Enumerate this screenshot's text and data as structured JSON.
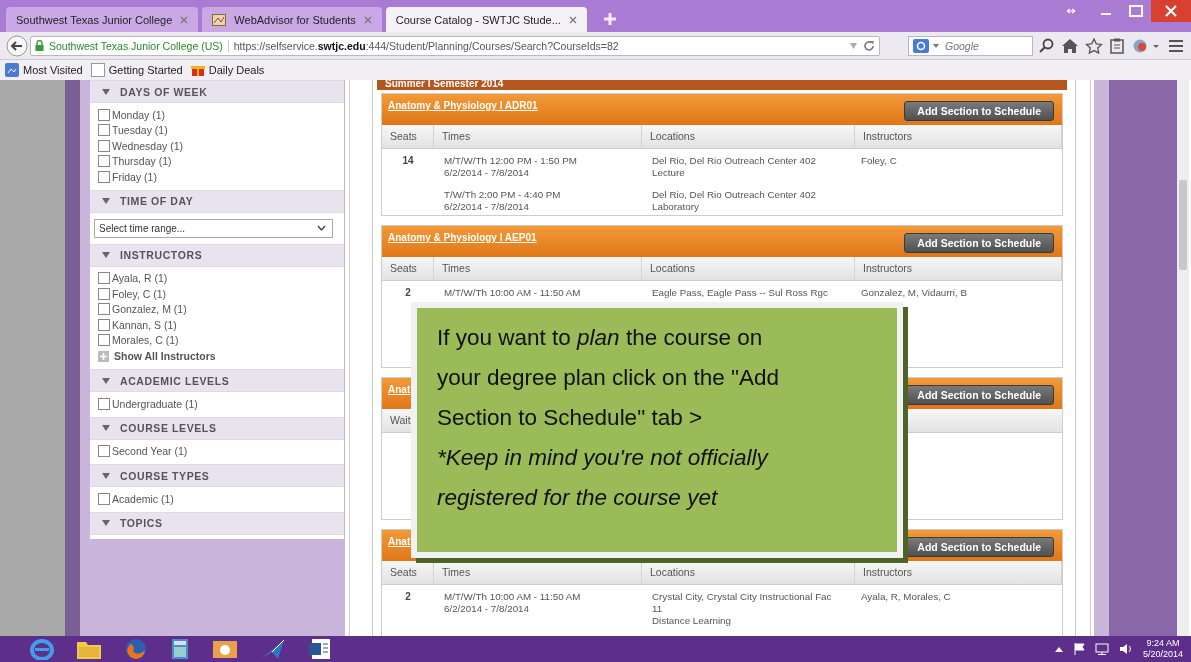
{
  "browser": {
    "tabs": [
      {
        "title": "Southwest Texas Junior College",
        "selected": false
      },
      {
        "title": "WebAdvisor for Students",
        "selected": false
      },
      {
        "title": "Course Catalog - SWTJC Stude...",
        "selected": true
      }
    ],
    "site_identity": "Southwest Texas Junior College (US)",
    "url": "https://selfservice.**swtjc.edu**:444/Student/Planning/Courses/Search?CourseIds=82",
    "search": {
      "placeholder": "Google"
    },
    "bookmarks": [
      "Most Visited",
      "Getting Started",
      "Daily Deals"
    ]
  },
  "sidebar": {
    "sections": [
      {
        "title": "DAYS OF WEEK",
        "expanded": true,
        "items": [
          {
            "kind": "checkbox",
            "label": "Monday (1)",
            "checked": false
          },
          {
            "kind": "checkbox",
            "label": "Tuesday (1)",
            "checked": false
          },
          {
            "kind": "checkbox",
            "label": "Wednesday (1)",
            "checked": false
          },
          {
            "kind": "checkbox",
            "label": "Thursday (1)",
            "checked": false
          },
          {
            "kind": "checkbox",
            "label": "Friday (1)",
            "checked": false
          }
        ]
      },
      {
        "title": "TIME OF DAY",
        "expanded": true,
        "items": [
          {
            "kind": "select",
            "value": "Select time range..."
          }
        ]
      },
      {
        "title": "INSTRUCTORS",
        "expanded": true,
        "items": [
          {
            "kind": "checkbox",
            "label": "Ayala, R (1)",
            "checked": false
          },
          {
            "kind": "checkbox",
            "label": "Foley, C (1)",
            "checked": false
          },
          {
            "kind": "checkbox",
            "label": "Gonzalez, M (1)",
            "checked": false
          },
          {
            "kind": "checkbox",
            "label": "Kannan, S (1)",
            "checked": false
          },
          {
            "kind": "checkbox",
            "label": "Morales, C (1)",
            "checked": false
          },
          {
            "kind": "more",
            "label": "Show All Instructors"
          }
        ]
      },
      {
        "title": "ACADEMIC LEVELS",
        "expanded": true,
        "items": [
          {
            "kind": "checkbox",
            "label": "Undergraduate (1)",
            "checked": false
          }
        ]
      },
      {
        "title": "COURSE LEVELS",
        "expanded": true,
        "items": [
          {
            "kind": "checkbox",
            "label": "Second Year (1)",
            "checked": false
          }
        ]
      },
      {
        "title": "COURSE TYPES",
        "expanded": true,
        "items": [
          {
            "kind": "checkbox",
            "label": "Academic (1)",
            "checked": false
          }
        ]
      },
      {
        "title": "TOPICS",
        "expanded": true
      }
    ]
  },
  "term": "Summer I Semester 2014",
  "sections": [
    {
      "title": "Anatomy & Physiology I ADR01",
      "button": "Add Section to Schedule",
      "columns": [
        "Seats",
        "Times",
        "Locations",
        "Instructors"
      ],
      "rows": [
        {
          "seats": "14",
          "instructors": "Foley, C",
          "meetings": [
            {
              "times": [
                "M/T/W/Th 12:00 PM - 1:50 PM",
                "6/2/2014 - 7/8/2014"
              ],
              "locations": [
                "Del Rio, Del Rio Outreach Center 402",
                "Lecture"
              ]
            },
            {
              "times": [
                "T/W/Th 2:00 PM - 4:40 PM",
                "6/2/2014 - 7/8/2014"
              ],
              "locations": [
                "Del Rio, Del Rio Outreach Center 402",
                "Laboratory"
              ]
            }
          ]
        }
      ]
    },
    {
      "title": "Anatomy & Physiology I AEP01",
      "button": "Add Section to Schedule",
      "columns": [
        "Seats",
        "Times",
        "Locations",
        "Instructors"
      ],
      "rows": [
        {
          "seats": "2",
          "instructors": "Gonzalez, M, Vidaurri, B",
          "meetings": [
            {
              "times": [
                "M/T/W/Th 10:00 AM - 11:50 AM"
              ],
              "locations": [
                "Eagle Pass, Eagle Pass -- Sul Ross Rgc"
              ]
            }
          ]
        }
      ]
    },
    {
      "title": "Anat",
      "button": "Add Section to Schedule",
      "columns": [
        "Wait"
      ]
    },
    {
      "title": "Anat",
      "button": "Add Section to Schedule",
      "columns": [
        "Seats",
        "Times",
        "Locations",
        "Instructors"
      ],
      "rows": [
        {
          "seats": "2",
          "instructors": "Ayala, R, Morales, C",
          "meetings": [
            {
              "times": [
                "M/T/W/Th 10:00 AM - 11:50 AM",
                "6/2/2014 - 7/8/2014"
              ],
              "locations": [
                "Crystal City, Crystal City Instructional Fac",
                "11",
                "Distance Learning"
              ]
            }
          ]
        }
      ]
    }
  ],
  "callout": {
    "text": "If you want to *plan* the course on your degree plan click on the \"Add Section to Schedule\" tab >",
    "note": "*Keep in mind you're not officially registered for the course yet"
  },
  "taskbar": {
    "time": "9:24 AM",
    "date": "5/20/2014"
  }
}
